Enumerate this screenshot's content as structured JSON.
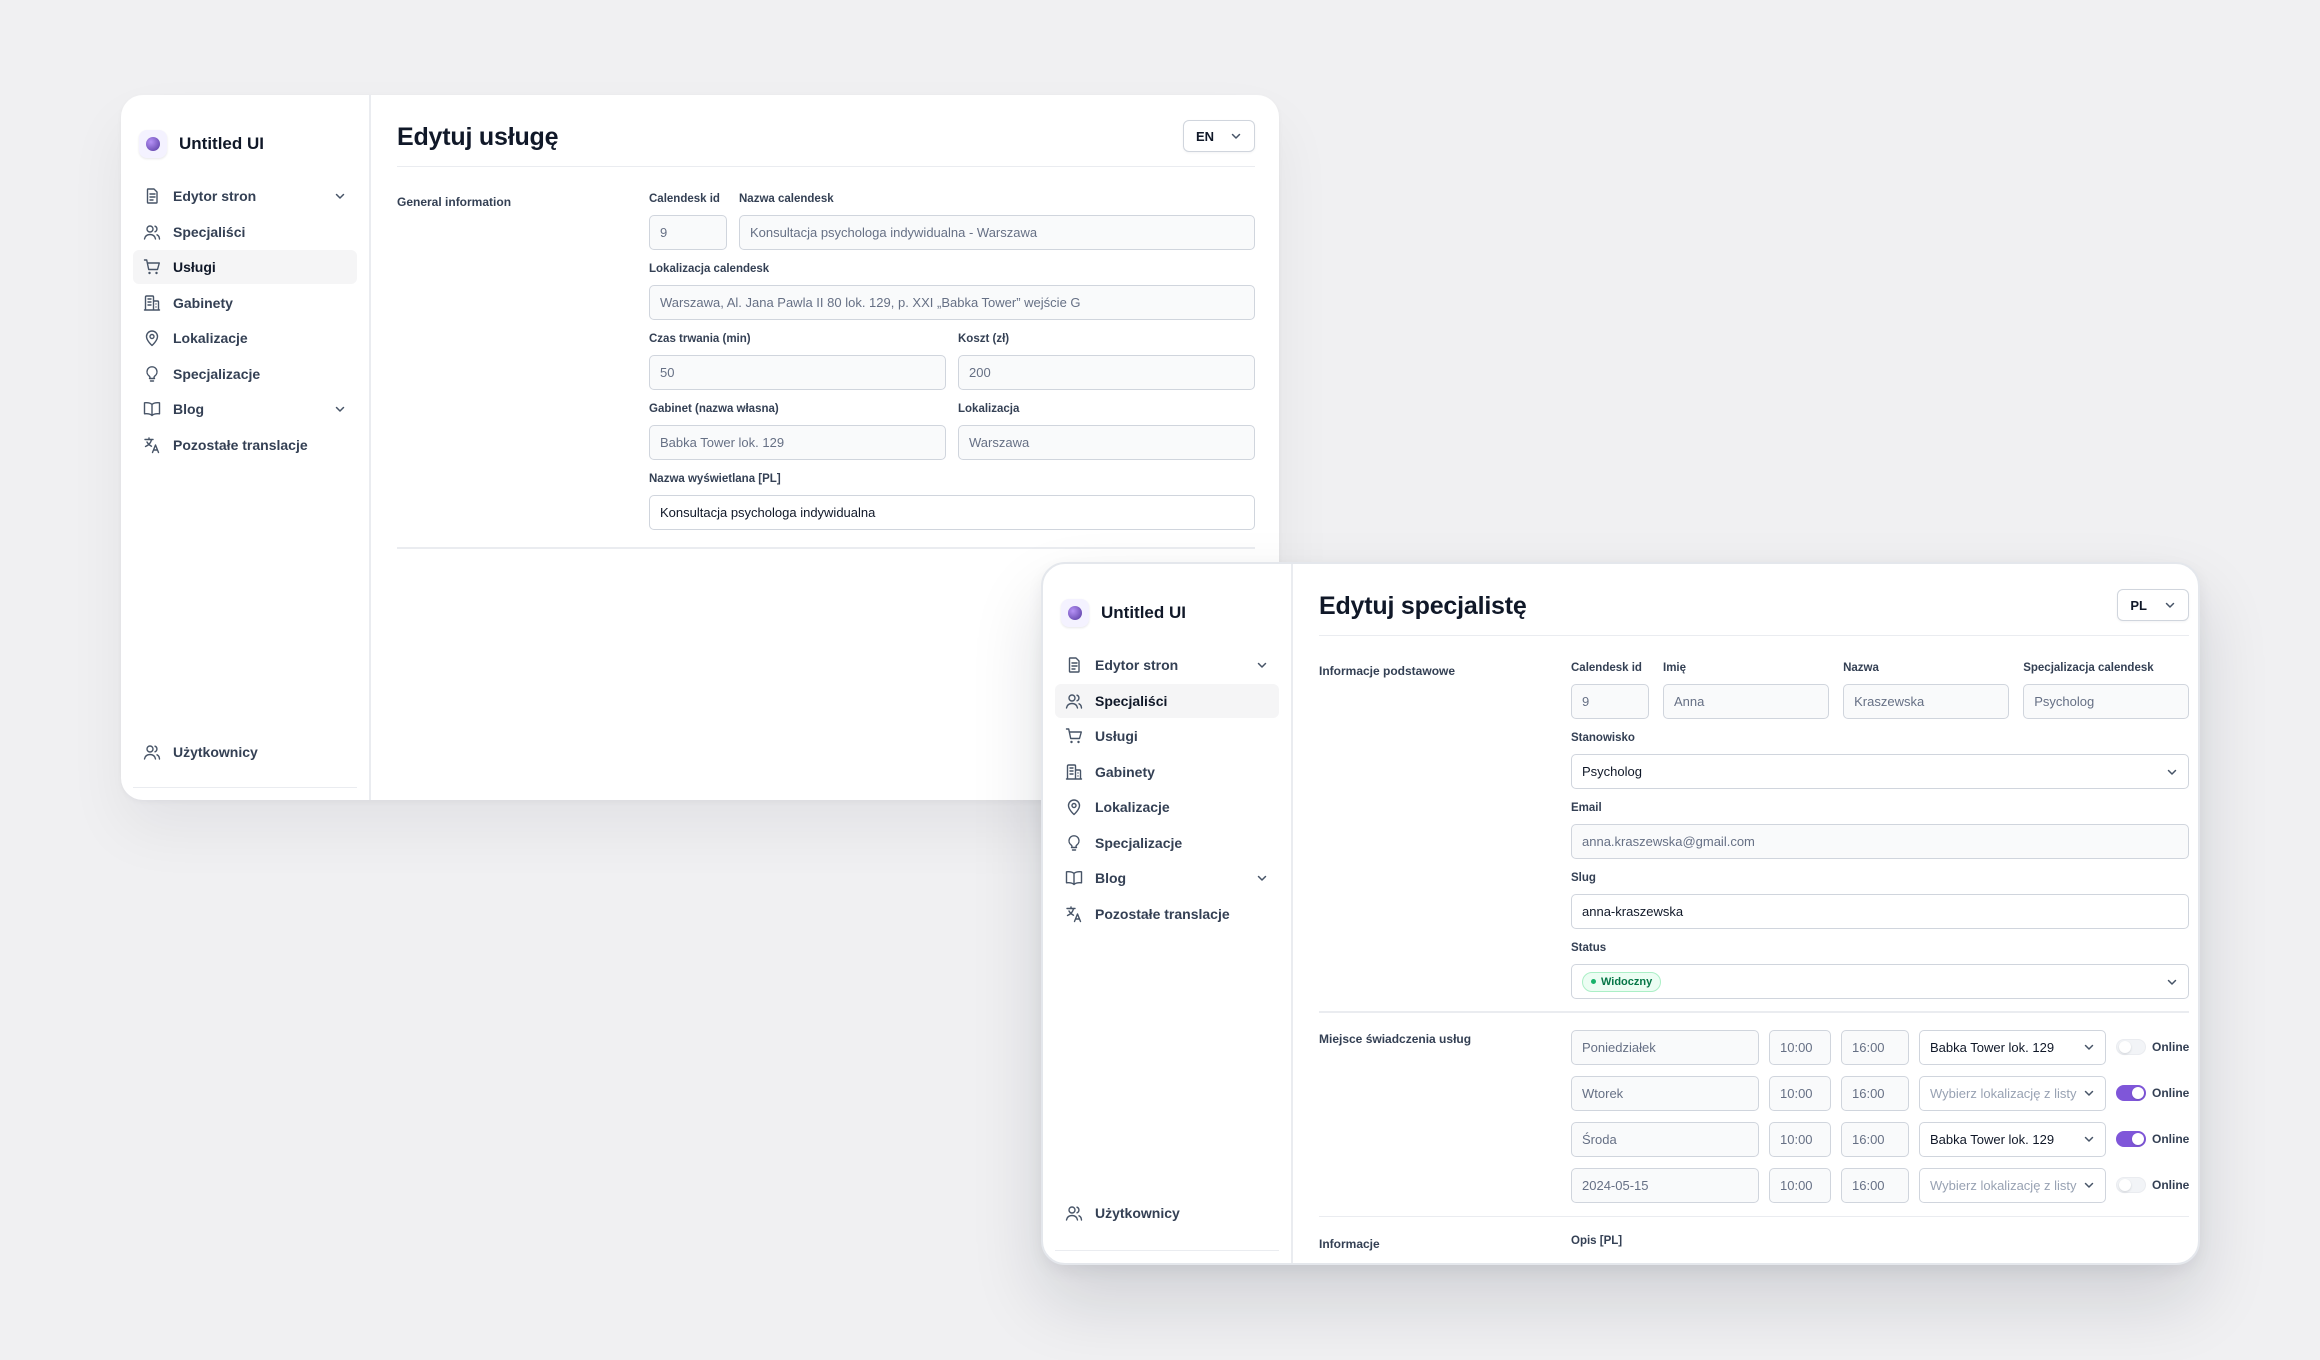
{
  "window1": {
    "brand": "Untitled UI",
    "nav": [
      {
        "label": "Edytor stron",
        "icon": "document-icon",
        "chevron": true,
        "active": false
      },
      {
        "label": "Specjaliści",
        "icon": "users-icon",
        "chevron": false,
        "active": false
      },
      {
        "label": "Usługi",
        "icon": "cart-icon",
        "chevron": false,
        "active": true
      },
      {
        "label": "Gabinety",
        "icon": "building-icon",
        "chevron": false,
        "active": false
      },
      {
        "label": "Lokalizacje",
        "icon": "map-pin-icon",
        "chevron": false,
        "active": false
      },
      {
        "label": "Specjalizacje",
        "icon": "lightbulb-icon",
        "chevron": false,
        "active": false
      },
      {
        "label": "Blog",
        "icon": "book-icon",
        "chevron": true,
        "active": false
      },
      {
        "label": "Pozostałe translacje",
        "icon": "translate-icon",
        "chevron": false,
        "active": false
      }
    ],
    "nav_bottom": {
      "label": "Użytkownicy",
      "icon": "users-icon"
    },
    "title": "Edytuj usługę",
    "lang": "EN",
    "section_title": "General information",
    "fields": {
      "calendesk_id": {
        "label": "Calendesk id",
        "value": "9"
      },
      "nazwa_calendesk": {
        "label": "Nazwa calendesk",
        "value": "Konsultacja psychologa indywidualna - Warszawa"
      },
      "lokalizacja_calendesk": {
        "label": "Lokalizacja calendesk",
        "value": "Warszawa, Al. Jana Pawla II 80 lok. 129, p. XXI „Babka Tower” wejście G"
      },
      "czas_trwania": {
        "label": "Czas trwania (min)",
        "value": "50"
      },
      "koszt": {
        "label": "Koszt (zł)",
        "value": "200"
      },
      "gabinet": {
        "label": "Gabinet (nazwa własna)",
        "value": "Babka Tower lok. 129"
      },
      "lokalizacja": {
        "label": "Lokalizacja",
        "value": "Warszawa"
      },
      "nazwa_wyswietlana": {
        "label": "Nazwa wyświetlana [PL]",
        "value": "Konsultacja psychologa indywidualna"
      }
    }
  },
  "window2": {
    "brand": "Untitled UI",
    "nav": [
      {
        "label": "Edytor stron",
        "icon": "document-icon",
        "chevron": true,
        "active": false
      },
      {
        "label": "Specjaliści",
        "icon": "users-icon",
        "chevron": false,
        "active": true
      },
      {
        "label": "Usługi",
        "icon": "cart-icon",
        "chevron": false,
        "active": false
      },
      {
        "label": "Gabinety",
        "icon": "building-icon",
        "chevron": false,
        "active": false
      },
      {
        "label": "Lokalizacje",
        "icon": "map-pin-icon",
        "chevron": false,
        "active": false
      },
      {
        "label": "Specjalizacje",
        "icon": "lightbulb-icon",
        "chevron": false,
        "active": false
      },
      {
        "label": "Blog",
        "icon": "book-icon",
        "chevron": true,
        "active": false
      },
      {
        "label": "Pozostałe translacje",
        "icon": "translate-icon",
        "chevron": false,
        "active": false
      }
    ],
    "nav_bottom": {
      "label": "Użytkownicy",
      "icon": "users-icon"
    },
    "title": "Edytuj specjalistę",
    "lang": "PL",
    "section_basic": "Informacje podstawowe",
    "fields": {
      "calendesk_id": {
        "label": "Calendesk id",
        "value": "9"
      },
      "imie": {
        "label": "Imię",
        "value": "Anna"
      },
      "nazwa": {
        "label": "Nazwa",
        "value": "Kraszewska"
      },
      "specjalizacja": {
        "label": "Specjalizacja calendesk",
        "value": "Psycholog"
      },
      "stanowisko": {
        "label": "Stanowisko",
        "value": "Psycholog"
      },
      "email": {
        "label": "Email",
        "value": "anna.kraszewska@gmail.com"
      },
      "slug": {
        "label": "Slug",
        "value": "anna-kraszewska"
      },
      "status": {
        "label": "Status",
        "value": "Widoczny"
      }
    },
    "section_places": "Miejsce świadczenia usług",
    "schedule": [
      {
        "day": "Poniedziałek",
        "from": "10:00",
        "to": "16:00",
        "location": "Babka Tower lok. 129",
        "location_is_placeholder": false,
        "online_label": "Online",
        "online": false
      },
      {
        "day": "Wtorek",
        "from": "10:00",
        "to": "16:00",
        "location": "Wybierz lokalizację z listy",
        "location_is_placeholder": true,
        "online_label": "Online",
        "online": true
      },
      {
        "day": "Środa",
        "from": "10:00",
        "to": "16:00",
        "location": "Babka Tower lok. 129",
        "location_is_placeholder": false,
        "online_label": "Online",
        "online": true
      },
      {
        "day": "2024-05-15",
        "from": "10:00",
        "to": "16:00",
        "location": "Wybierz lokalizację z listy",
        "location_is_placeholder": true,
        "online_label": "Online",
        "online": false
      }
    ],
    "section_info": "Informacje",
    "opis_label": "Opis [PL]"
  }
}
